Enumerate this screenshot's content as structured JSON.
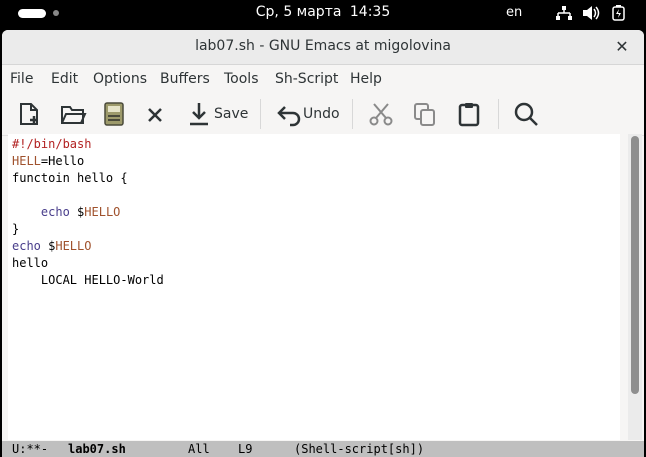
{
  "topbar": {
    "date": "Ср, 5 марта",
    "time": "14:35",
    "lang": "en",
    "icons": [
      "network-icon",
      "volume-icon",
      "battery-icon"
    ]
  },
  "window": {
    "title": "lab07.sh - GNU Emacs at migolovina"
  },
  "menubar": {
    "items": [
      "File",
      "Edit",
      "Options",
      "Buffers",
      "Tools",
      "Sh-Script",
      "Help"
    ]
  },
  "toolbar": {
    "save_label": "Save",
    "undo_label": "Undo",
    "icons": [
      "new-file-icon",
      "open-folder-icon",
      "save-disk-icon",
      "close-buffer-icon",
      "save-icon",
      "undo-icon",
      "cut-icon",
      "copy-icon",
      "paste-icon",
      "search-icon"
    ]
  },
  "editor": {
    "lines": [
      {
        "segments": [
          {
            "text": "#!/bin/bash",
            "style": "comment"
          }
        ]
      },
      {
        "segments": [
          {
            "text": "HELL",
            "style": "var"
          },
          {
            "text": "=Hello",
            "style": "plain"
          }
        ]
      },
      {
        "segments": [
          {
            "text": "functoin hello {",
            "style": "plain"
          }
        ]
      },
      {
        "segments": [
          {
            "text": "",
            "style": "plain"
          }
        ]
      },
      {
        "segments": [
          {
            "text": "    ",
            "style": "plain"
          },
          {
            "text": "echo",
            "style": "builtin"
          },
          {
            "text": " $",
            "style": "plain"
          },
          {
            "text": "HELLO",
            "style": "var"
          }
        ]
      },
      {
        "segments": [
          {
            "text": "}",
            "style": "plain"
          }
        ]
      },
      {
        "segments": [
          {
            "text": "echo",
            "style": "builtin"
          },
          {
            "text": " $",
            "style": "plain"
          },
          {
            "text": "HELLO",
            "style": "var"
          }
        ]
      },
      {
        "segments": [
          {
            "text": "hello",
            "style": "plain"
          }
        ]
      },
      {
        "segments": [
          {
            "text": "    LOCAL HELLO-World",
            "style": "plain"
          }
        ]
      }
    ],
    "colors": {
      "comment": "#b22222",
      "var": "#a0522d",
      "builtin": "#483d8b"
    }
  },
  "modeline": {
    "status": "U:**-",
    "buffer": "lab07.sh",
    "position": "All",
    "line": "L9",
    "mode": "(Shell-script[sh])"
  }
}
